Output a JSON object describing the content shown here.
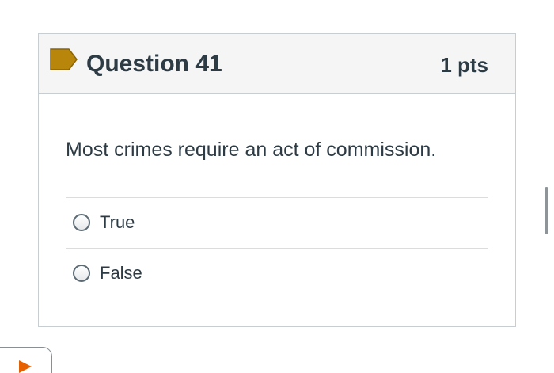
{
  "question": {
    "title": "Question 41",
    "points": "1 pts",
    "text": "Most crimes require an act of commission.",
    "flag_icon": "bookmark-flag-icon",
    "flag_color": "#b8860b"
  },
  "answers": [
    {
      "label": "True",
      "selected": false
    },
    {
      "label": "False",
      "selected": false
    }
  ],
  "ui": {
    "play_icon": "play-icon",
    "play_color": "#e66000"
  }
}
